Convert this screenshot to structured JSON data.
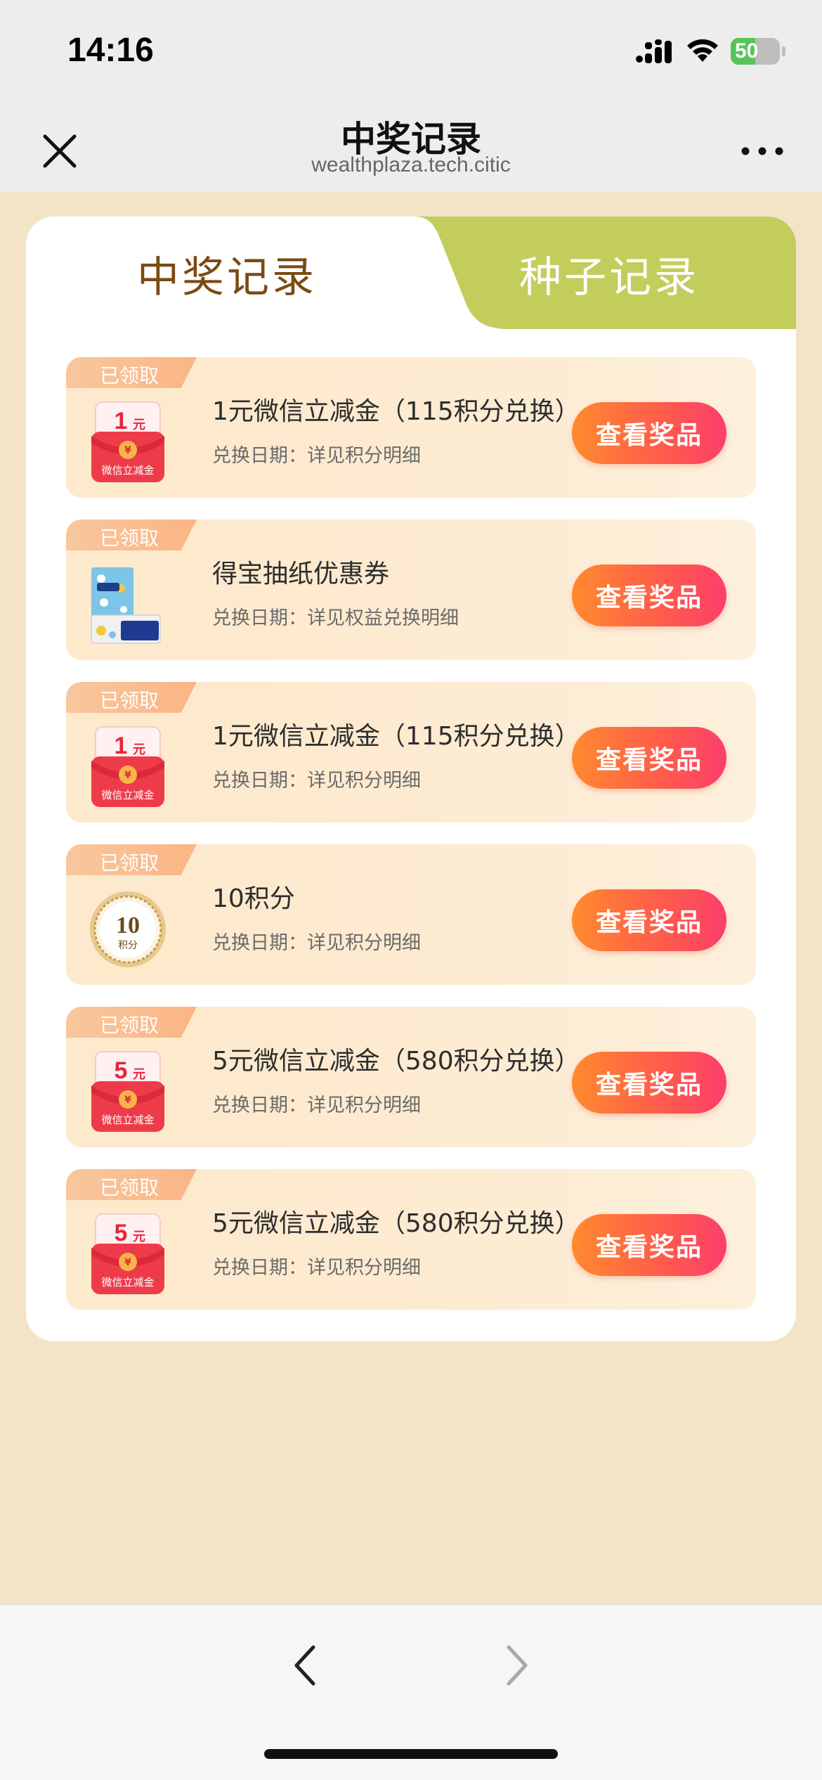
{
  "status_bar": {
    "time": "14:16",
    "battery_percent": 50,
    "battery_label": "50"
  },
  "nav": {
    "title": "中奖记录",
    "subtitle": "wealthplaza.tech.citic",
    "close_icon": "close-icon",
    "more_icon": "more-icon"
  },
  "tabs": [
    {
      "label": "中奖记录",
      "active": true
    },
    {
      "label": "种子记录",
      "active": false
    }
  ],
  "records": [
    {
      "badge": "已领取",
      "title": "1元微信立减金（115积分兑换）",
      "date": "兑换日期：详见积分明细",
      "button": "查看奖品",
      "thumb_type": "wechat-voucher",
      "thumb_amount": "1",
      "thumb_unit": "元",
      "thumb_caption": "微信立减金"
    },
    {
      "badge": "已领取",
      "title": "得宝抽纸优惠券",
      "date": "兑换日期：详见权益兑换明细",
      "button": "查看奖品",
      "thumb_type": "tissue",
      "thumb_amount": "",
      "thumb_unit": "",
      "thumb_caption": ""
    },
    {
      "badge": "已领取",
      "title": "1元微信立减金（115积分兑换）",
      "date": "兑换日期：详见积分明细",
      "button": "查看奖品",
      "thumb_type": "wechat-voucher",
      "thumb_amount": "1",
      "thumb_unit": "元",
      "thumb_caption": "微信立减金"
    },
    {
      "badge": "已领取",
      "title": "10积分",
      "date": "兑换日期：详见积分明细",
      "button": "查看奖品",
      "thumb_type": "points-coin",
      "thumb_amount": "10",
      "thumb_unit": "",
      "thumb_caption": "积分"
    },
    {
      "badge": "已领取",
      "title": "5元微信立减金（580积分兑换）",
      "date": "兑换日期：详见积分明细",
      "button": "查看奖品",
      "thumb_type": "wechat-voucher",
      "thumb_amount": "5",
      "thumb_unit": "元",
      "thumb_caption": "微信立减金"
    },
    {
      "badge": "已领取",
      "title": "5元微信立减金（580积分兑换）",
      "date": "兑换日期：详见积分明细",
      "button": "查看奖品",
      "thumb_type": "wechat-voucher",
      "thumb_amount": "5",
      "thumb_unit": "元",
      "thumb_caption": "微信立减金"
    }
  ],
  "bottom_bar": {
    "back_icon": "chevron-left-icon",
    "forward_icon": "chevron-right-icon"
  },
  "colors": {
    "page_background": "#f3e4c8",
    "active_tab_text": "#7b4a14",
    "inactive_tab_background": "#c2cd5c",
    "button_gradient_start": "#ff8a2e",
    "button_gradient_end": "#fc3f6b",
    "badge": "#f8c79e"
  }
}
